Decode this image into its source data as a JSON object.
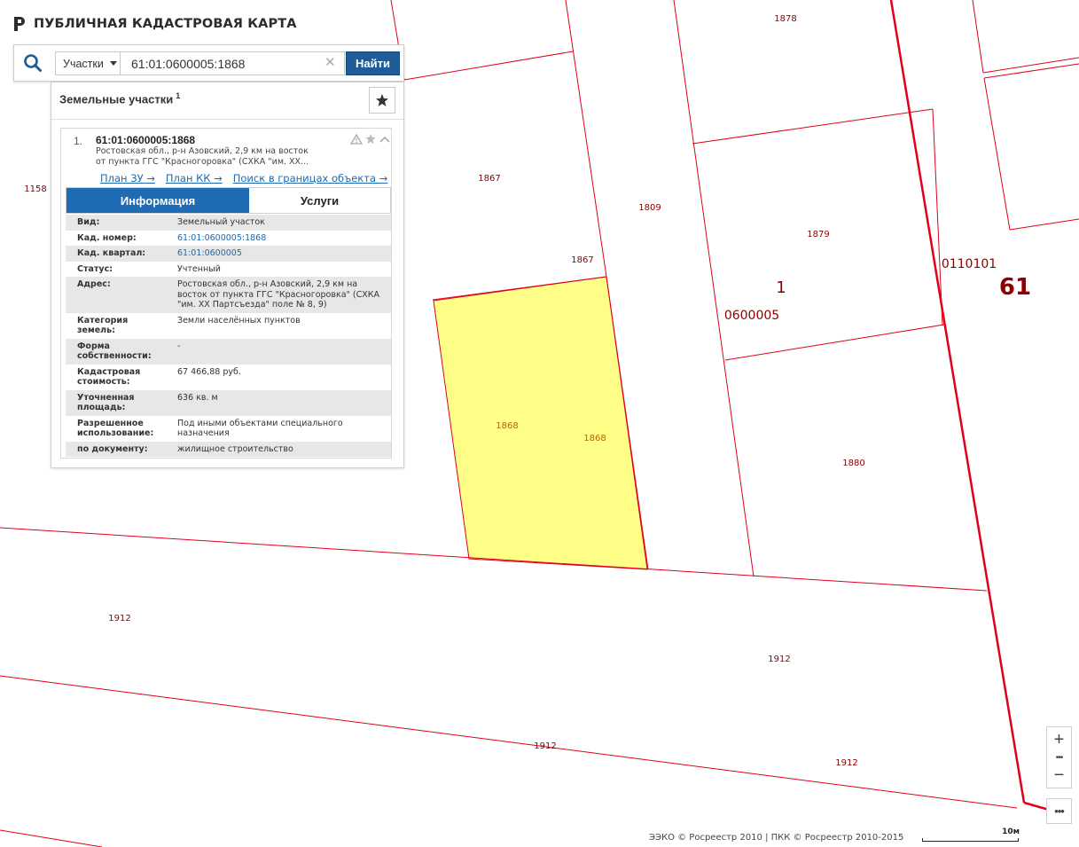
{
  "app": {
    "title": "ПУБЛИЧНАЯ КАДАСТРОВАЯ КАРТА"
  },
  "search": {
    "type_label": "Участки",
    "query_value": "61:01:0600005:1868",
    "find_label": "Найти"
  },
  "results": {
    "title": "Земельные участки",
    "count": "1",
    "item": {
      "index": "1.",
      "cad_number": "61:01:0600005:1868",
      "address_short": "Ростовская обл., р-н Азовский, 2,9 км на восток от пункта ГГС \"Красногоровка\" (СХКА \"им. XX...",
      "links": [
        "План ЗУ →",
        "План КК →",
        "Поиск в границах объекта →"
      ],
      "tabs": [
        "Информация",
        "Услуги"
      ],
      "fields": [
        {
          "key": "Вид:",
          "value": "Земельный участок"
        },
        {
          "key": "Кад. номер:",
          "value": "61:01:0600005:1868"
        },
        {
          "key": "Кад. квартал:",
          "value": "61:01:0600005"
        },
        {
          "key": "Статус:",
          "value": "Учтенный"
        },
        {
          "key": "Адрес:",
          "value": "Ростовская обл., р-н Азовский, 2,9 км на восток от пункта ГГС \"Красногоровка\" (СХКА \"им. XX Партсъезда\" поле № 8, 9)"
        },
        {
          "key": "Категория земель:",
          "value": "Земли населённых пунктов"
        },
        {
          "key": "Форма собственности:",
          "value": "-"
        },
        {
          "key": "Кадастровая стоимость:",
          "value": "67 466,88 руб."
        },
        {
          "key": "Уточненная площадь:",
          "value": "636 кв. м"
        },
        {
          "key": "Разрешенное использование:",
          "value": "Под иными объектами специального назначения"
        },
        {
          "key": "по документу:",
          "value": "жилищное строительство"
        }
      ]
    }
  },
  "map": {
    "parcel_labels": {
      "p1878": "1878",
      "p1158": "1158",
      "p1867a": "1867",
      "p1867b": "1867",
      "p1809": "1809",
      "p1879": "1879",
      "p1868a": "1868",
      "p1868b": "1868",
      "p1880": "1880",
      "p1912a": "1912",
      "p1912b": "1912",
      "p1912c": "1912",
      "p1912d": "1912"
    },
    "quarter_labels": {
      "q1": "1",
      "q2": "0600005",
      "q3": "0110101",
      "q4": "61"
    },
    "colors": {
      "boundary": "#e0001b",
      "selected_fill": "#ffff88",
      "label": "#8b0000"
    }
  },
  "controls": {
    "zoom_in": "+",
    "zoom_out": "−",
    "more": "•••"
  },
  "footer": {
    "attribution": "ЭЭКО © Росреестр 2010 | ПКК © Росреестр 2010-2015",
    "scale": "10м"
  }
}
